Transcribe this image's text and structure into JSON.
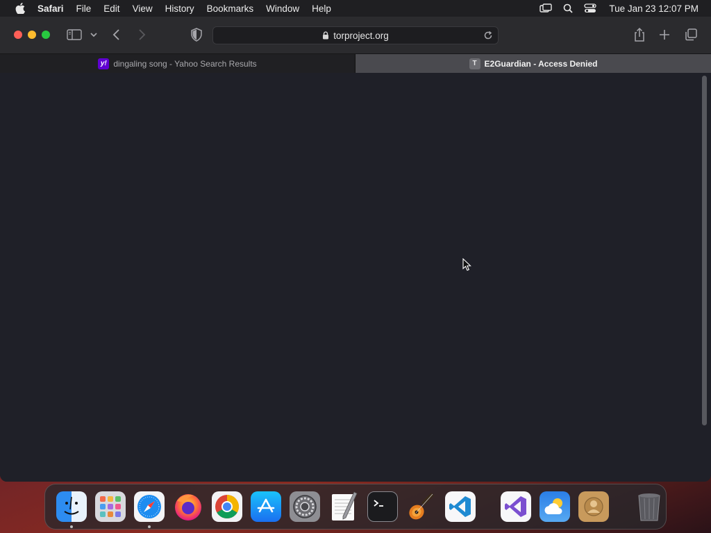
{
  "menubar": {
    "app_name": "Safari",
    "items": [
      "File",
      "Edit",
      "View",
      "History",
      "Bookmarks",
      "Window",
      "Help"
    ],
    "clock": "Tue Jan 23  12:07 PM"
  },
  "toolbar": {
    "url": "torproject.org"
  },
  "tabs": [
    {
      "title": "dingaling song - Yahoo Search Results",
      "favicon": "y!",
      "active": false
    },
    {
      "title": "E2Guardian - Access Denied",
      "favicon": "T",
      "active": true
    }
  ],
  "dock": {
    "apps": [
      "Finder",
      "Launchpad",
      "Safari",
      "Firefox",
      "Chrome",
      "App Store",
      "System Settings",
      "TextEdit",
      "Terminal",
      "GarageBand",
      "Visual Studio Code",
      "Visual Studio",
      "Weather",
      "Contacts",
      "Trash"
    ],
    "running": [
      "Finder",
      "Safari"
    ]
  },
  "colors": {
    "close": "#fe5f57",
    "minimize": "#febc2e",
    "maximize": "#28c840",
    "page_bg": "#1f2028",
    "yahoo": "#5f01d1"
  }
}
